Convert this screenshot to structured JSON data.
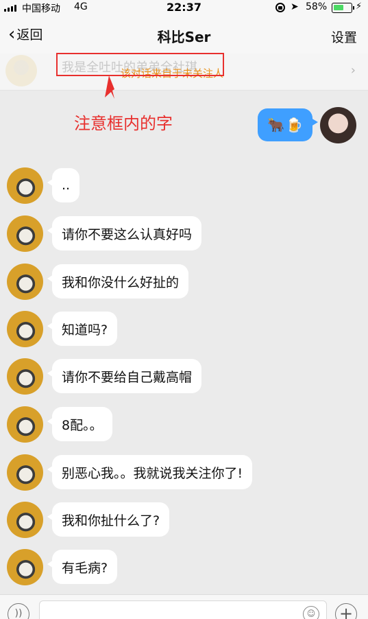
{
  "status_bar": {
    "carrier": "中国移动",
    "network": "4G",
    "time": "22:37",
    "battery_pct": "58%",
    "battery_level": 0.58,
    "location_glyph": "➤",
    "charging_glyph": "⚡"
  },
  "nav": {
    "back_label": "返回",
    "back_glyph": "‹",
    "title": "科比Ser",
    "settings_label": "设置"
  },
  "notice": {
    "faded_text": "我是全吐吐的弟弟全社琪",
    "source_text": "该对话来自于未关注人",
    "chevron": "›"
  },
  "annotation": {
    "text": "注意框内的字",
    "color": "#e8302e"
  },
  "outgoing": {
    "emojis": [
      "🐂",
      "🍺"
    ]
  },
  "messages": [
    {
      "text": ".."
    },
    {
      "text": "请你不要这么认真好吗"
    },
    {
      "text": "我和你没什么好扯的"
    },
    {
      "text": "知道吗?"
    },
    {
      "text": "请你不要给自己戴高帽"
    },
    {
      "text": "8配。。"
    },
    {
      "text": "别恶心我。。我就说我关注你了!"
    },
    {
      "text": "我和你扯什么了?"
    },
    {
      "text": "有毛病?"
    }
  ],
  "input_bar": {
    "voice_glyph": "))",
    "emoji_glyph": "☺",
    "plus_glyph": "+"
  },
  "colors": {
    "background": "#ebebeb",
    "bubble_out": "#3f9fff",
    "bubble_in": "#ffffff",
    "source_text": "#e8901a",
    "battery": "#4cd964"
  }
}
